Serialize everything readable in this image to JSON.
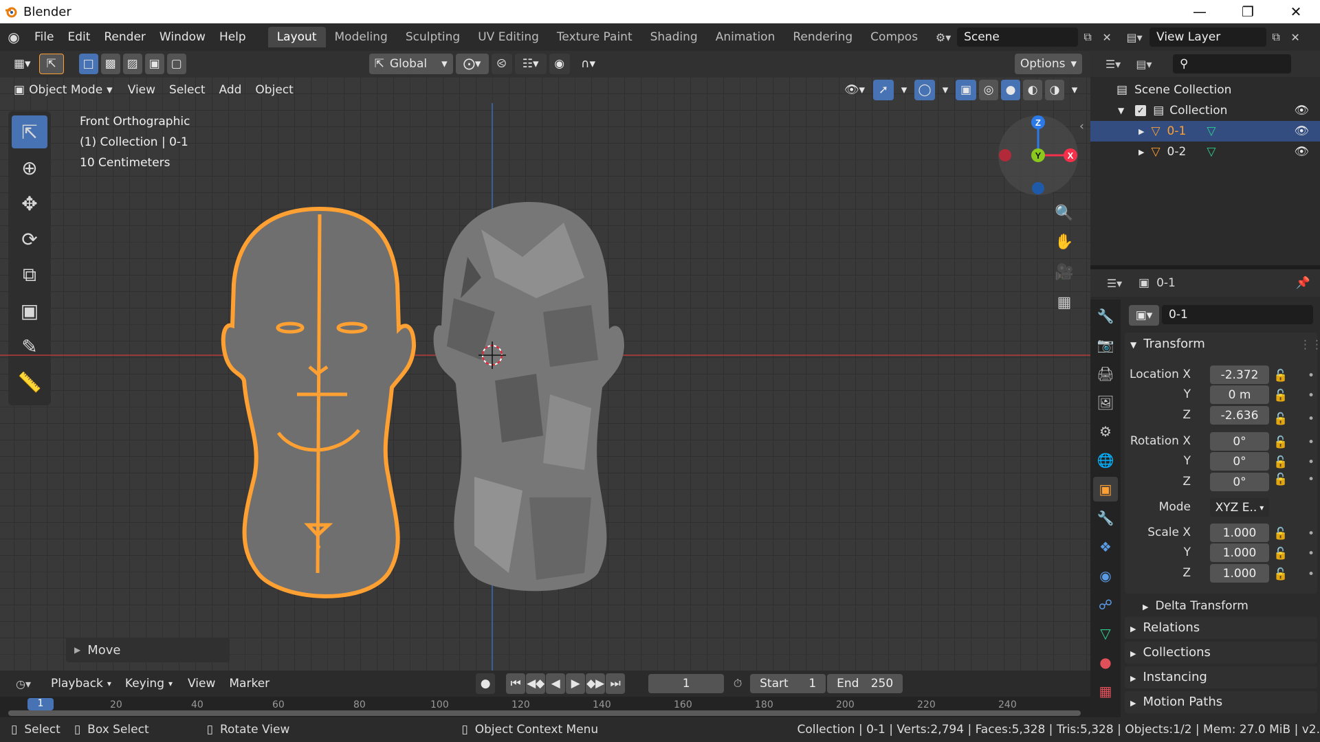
{
  "window": {
    "title": "Blender",
    "buttons": [
      "minimize-icon",
      "restore-icon",
      "close-icon"
    ]
  },
  "menu": {
    "items": [
      "File",
      "Edit",
      "Render",
      "Window",
      "Help"
    ]
  },
  "workspaces": {
    "tabs": [
      "Layout",
      "Modeling",
      "Sculpting",
      "UV Editing",
      "Texture Paint",
      "Shading",
      "Animation",
      "Rendering",
      "Compos"
    ],
    "active": "Layout"
  },
  "scene": {
    "name": "Scene"
  },
  "view_layer": {
    "name": "View Layer"
  },
  "viewport_header": {
    "orientation": "Global",
    "options_label": "Options"
  },
  "viewport_header2": {
    "mode": "Object Mode",
    "menus": [
      "View",
      "Select",
      "Add",
      "Object"
    ]
  },
  "viewport_info": {
    "view_name": "Front Orthographic",
    "collection_line": "(1) Collection | 0-1",
    "scale_line": "10 Centimeters"
  },
  "gizmo": {
    "axes": [
      "Z",
      "Y",
      "X"
    ]
  },
  "last_operator": {
    "label": "Move"
  },
  "outliner": {
    "root": "Scene Collection",
    "collection": "Collection",
    "objects": [
      {
        "name": "0-1",
        "selected": true
      },
      {
        "name": "0-2",
        "selected": false
      }
    ]
  },
  "properties": {
    "object_name": "0-1",
    "data_name": "0-1",
    "transform_title": "Transform",
    "location": {
      "label": "Location X",
      "x": "-2.372",
      "y": "0 m",
      "z": "-2.636"
    },
    "rotation": {
      "label": "Rotation X",
      "x": "0°",
      "y": "0°",
      "z": "0°"
    },
    "mode": {
      "label": "Mode",
      "value": "XYZ E.."
    },
    "scale": {
      "label": "Scale X",
      "x": "1.000",
      "y": "1.000",
      "z": "1.000"
    },
    "axis_labels": {
      "y": "Y",
      "z": "Z"
    },
    "subpanels": [
      "Delta Transform"
    ],
    "panels": [
      "Relations",
      "Collections",
      "Instancing",
      "Motion Paths"
    ]
  },
  "timeline": {
    "menus": [
      "Playback",
      "Keying",
      "View",
      "Marker"
    ],
    "current_frame": "1",
    "start_label": "Start",
    "start": "1",
    "end_label": "End",
    "end": "250",
    "ruler": [
      "20",
      "40",
      "60",
      "80",
      "100",
      "120",
      "140",
      "160",
      "180",
      "200",
      "220",
      "240"
    ],
    "playhead": "1"
  },
  "status": {
    "select": "Select",
    "box_select": "Box Select",
    "rotate_view": "Rotate View",
    "context_menu": "Object Context Menu",
    "stats": "Collection | 0-1 | Verts:2,794 | Faces:5,328 | Tris:5,328 | Objects:1/2 | Mem: 27.0 MiB | v2."
  },
  "colors": {
    "accent": "#4772b3",
    "selection": "#ffa033",
    "x_axis": "#f5304a",
    "y_axis": "#8ac81e",
    "z_axis": "#2b7ae8"
  }
}
